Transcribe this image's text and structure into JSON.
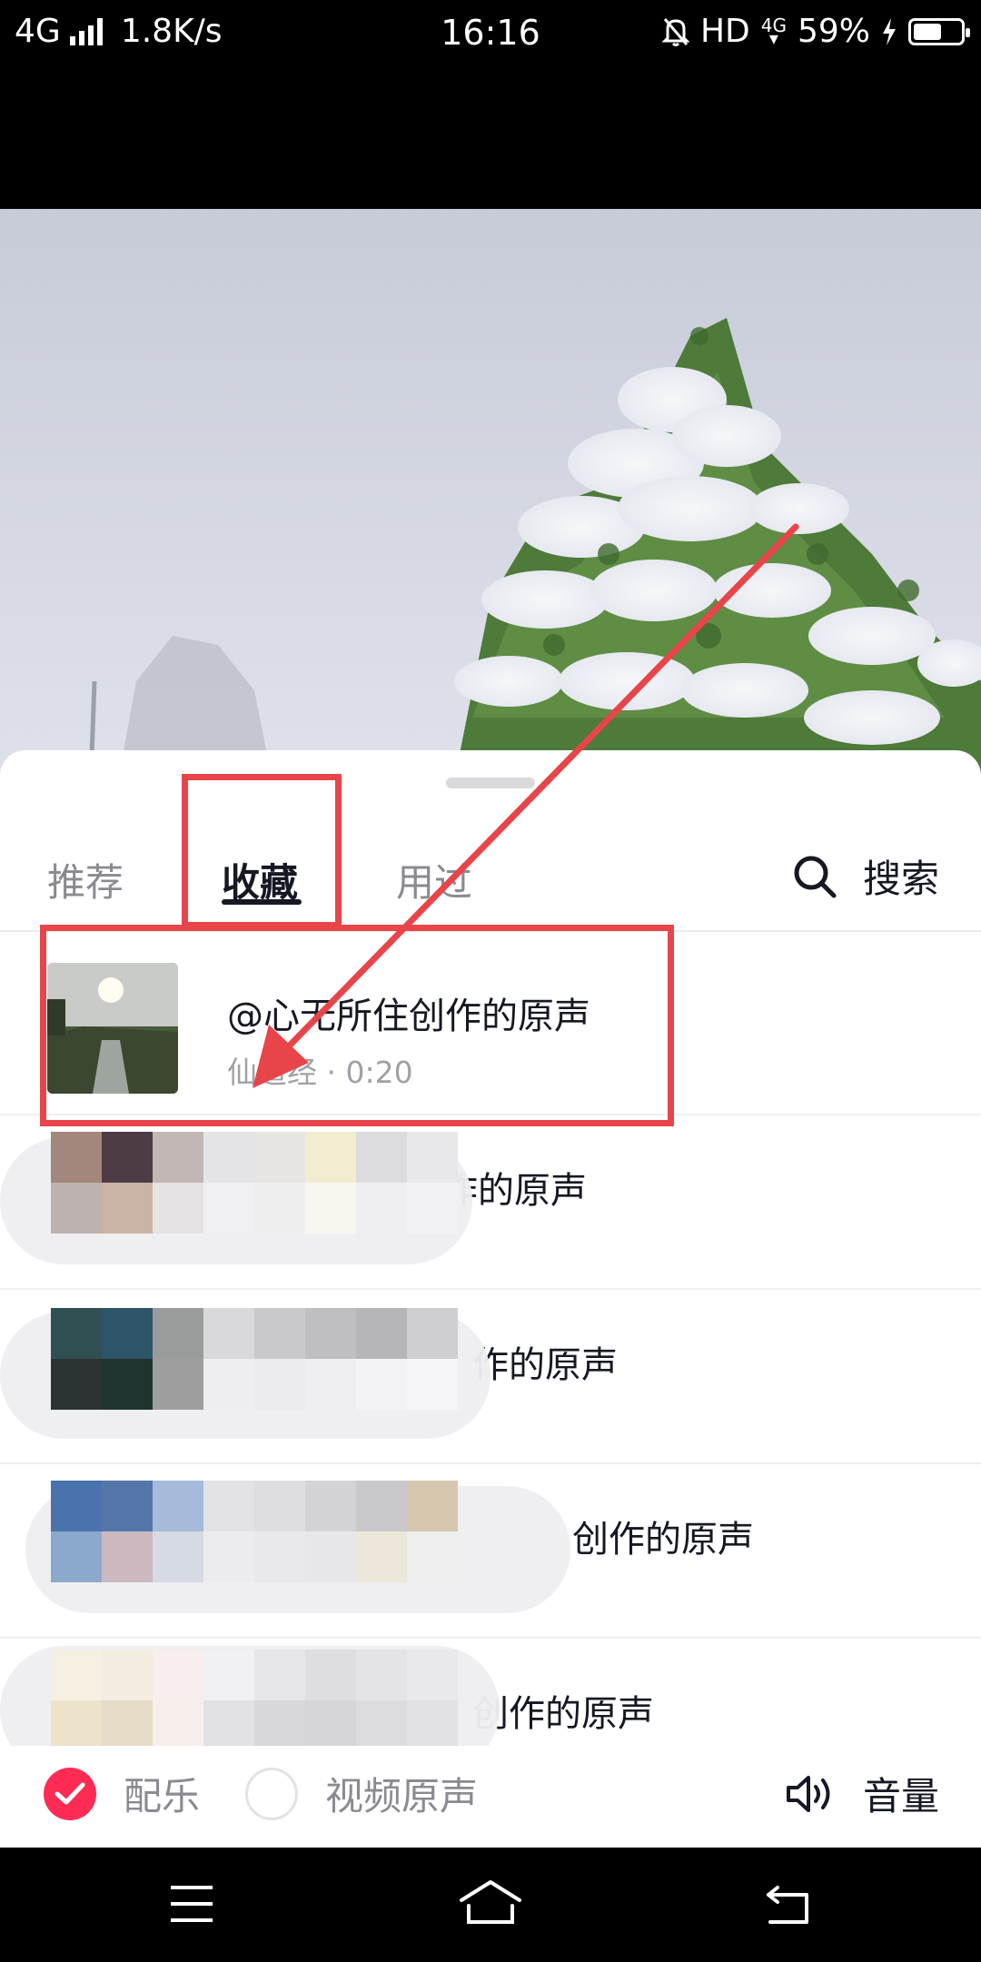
{
  "status_bar": {
    "network": "4G",
    "speed": "1.8K/s",
    "time": "16:16",
    "hd": "HD",
    "small_network": "4G",
    "battery": "59%",
    "battery_level": 0.59
  },
  "tabs": [
    {
      "label": "推荐",
      "active": false
    },
    {
      "label": "收藏",
      "active": true
    },
    {
      "label": "用过",
      "active": false
    }
  ],
  "search": {
    "label": "搜索",
    "icon": "search-icon"
  },
  "tracks": [
    {
      "title": "@心无所住创作的原声",
      "subtitle": "仙道经 · 0:20"
    },
    {
      "title": "作的原声"
    },
    {
      "title": "作的原声"
    },
    {
      "title": "创作的原声"
    },
    {
      "title": "创作的原声"
    }
  ],
  "options": {
    "music": {
      "label": "配乐",
      "checked": true
    },
    "original": {
      "label": "视频原声",
      "checked": false
    },
    "volume": {
      "label": "音量",
      "icon": "speaker-icon"
    }
  },
  "nav": {
    "icons": [
      "menu-icon",
      "home-icon",
      "back-icon"
    ]
  },
  "colors": {
    "accent": "#fe2c55",
    "annotation": "#e8454a"
  }
}
